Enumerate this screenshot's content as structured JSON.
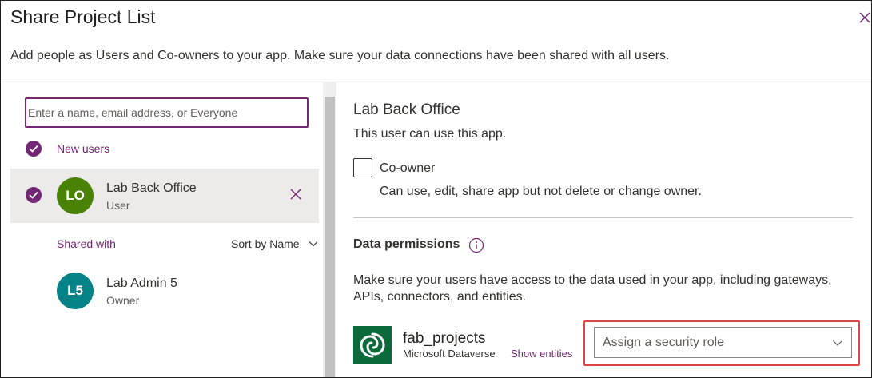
{
  "dialog": {
    "title": "Share Project List",
    "subtitle": "Add people as Users and Co-owners to your app. Make sure your data connections have been shared with all users.",
    "close_icon": "close-icon"
  },
  "left_pane": {
    "search": {
      "placeholder": "Enter a name, email address, or Everyone",
      "value": ""
    },
    "new_users_label": "New users",
    "selected_user": {
      "initials": "LO",
      "name": "Lab Back Office",
      "role": "User",
      "avatar_color": "#498205"
    },
    "shared_with_label": "Shared with",
    "sort_label": "Sort by Name",
    "shared_users": [
      {
        "initials": "L5",
        "name": "Lab Admin 5",
        "role": "Owner",
        "avatar_color": "#038387"
      }
    ]
  },
  "right_pane": {
    "user_heading": "Lab Back Office",
    "user_desc": "This user can use this app.",
    "coowner": {
      "label": "Co-owner",
      "checked": false,
      "desc": "Can use, edit, share app but not delete or change owner."
    },
    "data_permissions": {
      "heading": "Data permissions",
      "desc": "Make sure your users have access to the data used in your app, including gateways, APIs, connectors, and entities.",
      "sources": [
        {
          "name": "fab_projects",
          "type": "Microsoft Dataverse",
          "link": "Show entities",
          "icon": "dataverse-icon",
          "role_placeholder": "Assign a security role"
        }
      ]
    }
  },
  "colors": {
    "accent": "#742774",
    "highlight": "#e04545",
    "selected_row_bg": "#edebe9"
  }
}
